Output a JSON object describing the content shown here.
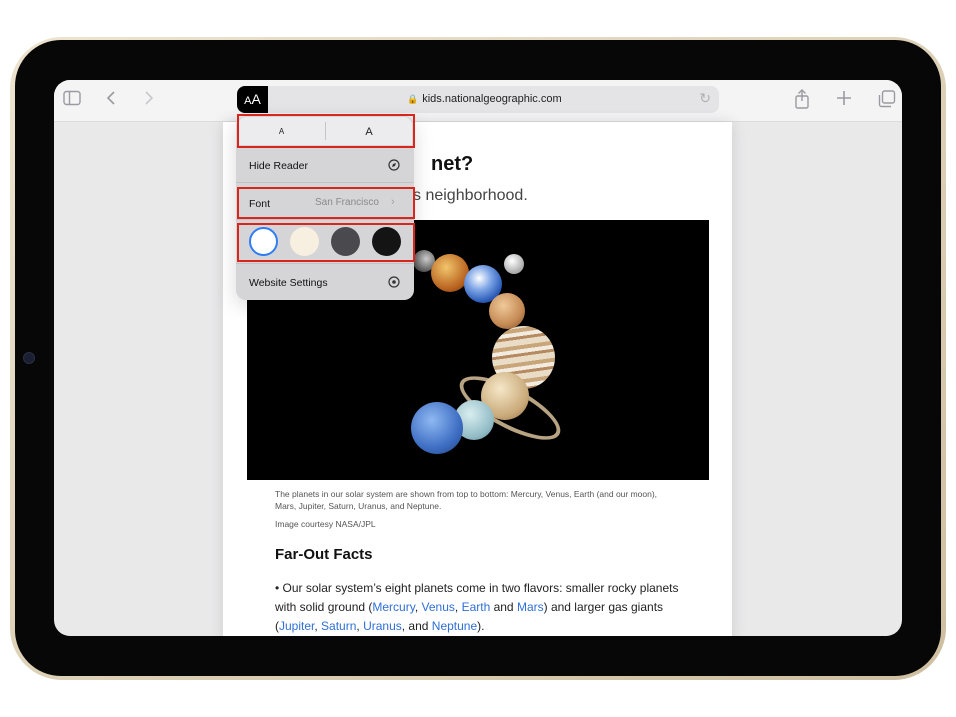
{
  "browser": {
    "url": "kids.nationalgeographic.com",
    "aa_label": "A",
    "aa_label_big": "A",
    "icons": [
      "sidebar-icon",
      "back-icon",
      "forward-icon",
      "lock-icon",
      "reload-icon",
      "share-icon",
      "new-tab-icon",
      "tabs-icon"
    ]
  },
  "article": {
    "title_visible": "net?",
    "subtitle_visible": "s neighborhood.",
    "caption": "The planets in our solar system are shown from top to bottom: Mercury, Venus, Earth (and our moon), Mars, Jupiter, Saturn, Uranus, and Neptune.",
    "credit": "Image courtesy NASA/JPL",
    "section_heading": "Far-Out Facts",
    "paragraph": {
      "part1": "• Our solar system’s eight planets come in two flavors: smaller rocky planets with solid ground (",
      "mercury": "Mercury",
      "comma1": ", ",
      "venus": "Venus",
      "comma2": ", ",
      "earth": "Earth",
      "and1": " and ",
      "mars": "Mars",
      "part2": ") and larger gas giants (",
      "jupiter": "Jupiter",
      "comma3": ", ",
      "saturn": "Saturn",
      "comma4": ", ",
      "uranus": "Uranus",
      "and2": ", and ",
      "neptune": "Neptune",
      "part3": ")."
    }
  },
  "reader_menu": {
    "font_size_small": "A",
    "font_size_large": "A",
    "hide_reader": "Hide Reader",
    "font_label": "Font",
    "font_value": "San Francisco",
    "themes": [
      {
        "name": "white",
        "color": "#ffffff",
        "selected": true
      },
      {
        "name": "sepia",
        "color": "#f7efdf",
        "selected": false
      },
      {
        "name": "gray",
        "color": "#4a4a4e",
        "selected": false
      },
      {
        "name": "black",
        "color": "#141414",
        "selected": false
      }
    ],
    "website_settings": "Website Settings"
  },
  "colors": {
    "highlight": "#d9251c",
    "link": "#2f6fd6",
    "selected_ring": "#2f7df6"
  }
}
